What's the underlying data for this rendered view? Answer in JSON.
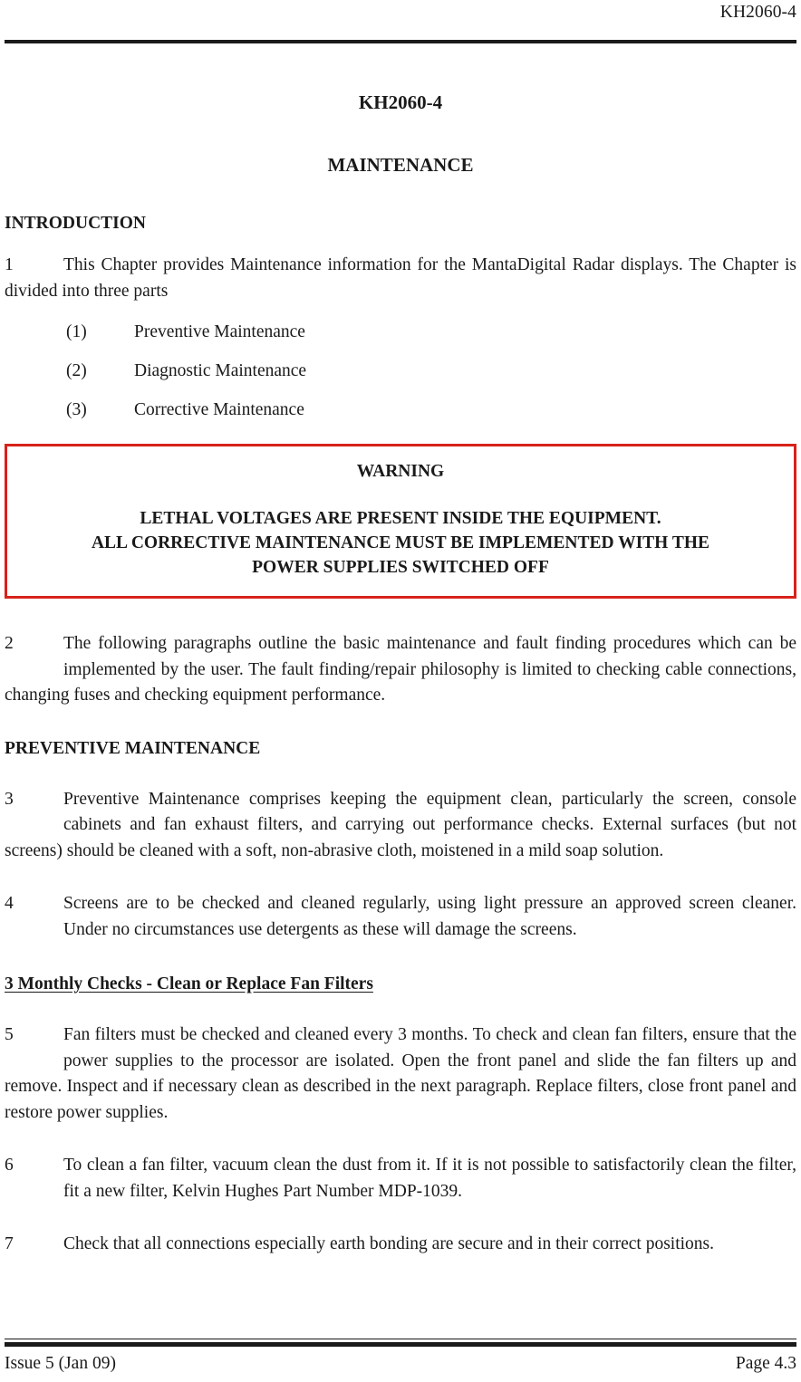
{
  "header": {
    "document_number": "KH2060-4"
  },
  "title": {
    "doc_title": "KH2060-4",
    "doc_subtitle": "MAINTENANCE"
  },
  "sections": {
    "introduction_heading": "INTRODUCTION",
    "preventive_maintenance_heading": "PREVENTIVE MAINTENANCE",
    "monthly_checks_heading": "3 Monthly Checks - Clean or Replace Fan Filters"
  },
  "paragraphs": {
    "p1": {
      "number": "1",
      "text": "This Chapter provides Maintenance information for the MantaDigital Radar displays. The Chapter is divided into three parts"
    },
    "p2": {
      "number": "2",
      "text": "The following paragraphs  outline the basic maintenance and fault finding procedures which can be implemented by the user. The fault finding/repair philosophy is limited to checking cable connections, changing fuses and checking equipment performance."
    },
    "p3": {
      "number": "3",
      "text": "Preventive Maintenance comprises keeping the equipment clean, particularly the screen, console cabinets and fan exhaust filters, and carrying out performance checks. External surfaces (but not screens) should be cleaned with a soft, non-abrasive cloth, moistened in a mild soap solution."
    },
    "p4": {
      "number": "4",
      "text": "Screens are to be checked and cleaned regularly, using light pressure an approved screen cleaner. Under no circumstances use detergents as these will damage the screens."
    },
    "p5": {
      "number": "5",
      "text": "Fan filters must be checked and cleaned every 3 months. To check and clean fan filters, ensure that the power supplies to the processor are isolated. Open the front panel and slide the fan filters up and remove. Inspect and if necessary clean as described in the next paragraph. Replace filters, close front panel and restore power supplies."
    },
    "p6": {
      "number": "6",
      "text": "To clean a fan filter, vacuum clean the dust from it. If it is not possible to satisfactorily clean the filter, fit a new filter, Kelvin Hughes Part Number MDP-1039."
    },
    "p7": {
      "number": "7",
      "text": "Check that all connections especially earth bonding are secure and in their correct positions."
    }
  },
  "sub_items": [
    {
      "marker": "(1)",
      "label": "Preventive Maintenance"
    },
    {
      "marker": "(2)",
      "label": "Diagnostic Maintenance"
    },
    {
      "marker": "(3)",
      "label": "Corrective Maintenance"
    }
  ],
  "warning": {
    "title": "WARNING",
    "line1": "LETHAL VOLTAGES ARE PRESENT INSIDE THE EQUIPMENT.",
    "line2": "ALL CORRECTIVE MAINTENANCE MUST BE IMPLEMENTED WITH THE",
    "line3": "POWER SUPPLIES SWITCHED OFF",
    "border_color": "#d8221a"
  },
  "footer": {
    "issue": "Issue 5 (Jan 09)",
    "page": "Page 4.3"
  }
}
